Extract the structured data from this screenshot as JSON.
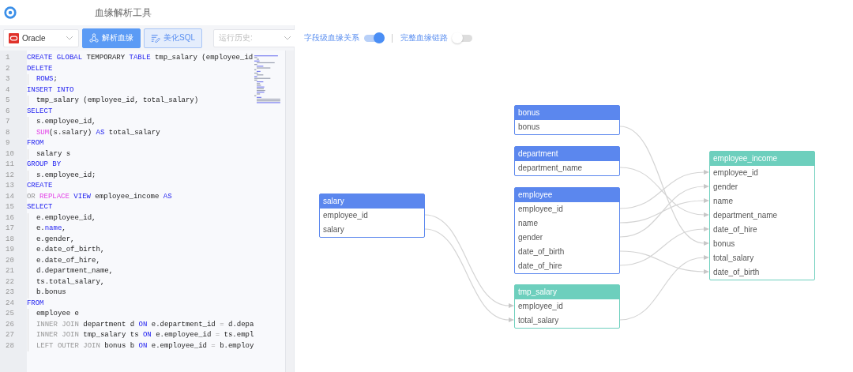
{
  "app": {
    "title": "血缘解析工具"
  },
  "toolbar": {
    "dialect": {
      "value": "Oracle"
    },
    "parse_button": "解析血缘",
    "format_button": "美化SQL",
    "history": {
      "placeholder": "运行历史:"
    }
  },
  "editor": {
    "lines": [
      {
        "no": "1",
        "indent": false,
        "tokens": [
          {
            "text": "CREATE GLOBAL",
            "kind": "keyword"
          },
          {
            "text": " TEMPORARY ",
            "kind": "plain"
          },
          {
            "text": "TABLE",
            "kind": "keyword"
          },
          {
            "text": " tmp_salary (employee_id",
            "kind": "plain"
          }
        ]
      },
      {
        "no": "2",
        "indent": false,
        "tokens": [
          {
            "text": "DELETE",
            "kind": "keyword"
          }
        ]
      },
      {
        "no": "3",
        "indent": true,
        "tokens": [
          {
            "text": "ROWS",
            "kind": "keyword"
          },
          {
            "text": ";",
            "kind": "plain"
          }
        ]
      },
      {
        "no": "4",
        "indent": false,
        "tokens": [
          {
            "text": "INSERT INTO",
            "kind": "keyword"
          }
        ]
      },
      {
        "no": "5",
        "indent": true,
        "tokens": [
          {
            "text": "tmp_salary (employee_id, total_salary)",
            "kind": "plain"
          }
        ]
      },
      {
        "no": "6",
        "indent": false,
        "tokens": [
          {
            "text": "SELECT",
            "kind": "keyword"
          }
        ]
      },
      {
        "no": "7",
        "indent": true,
        "tokens": [
          {
            "text": "s.employee_id,",
            "kind": "plain"
          }
        ]
      },
      {
        "no": "8",
        "indent": true,
        "tokens": [
          {
            "text": "SUM",
            "kind": "function"
          },
          {
            "text": "(s.salary) ",
            "kind": "plain"
          },
          {
            "text": "AS",
            "kind": "keyword"
          },
          {
            "text": " total_salary",
            "kind": "plain"
          }
        ]
      },
      {
        "no": "9",
        "indent": false,
        "tokens": [
          {
            "text": "FROM",
            "kind": "keyword"
          }
        ]
      },
      {
        "no": "10",
        "indent": true,
        "tokens": [
          {
            "text": "salary s",
            "kind": "plain"
          }
        ]
      },
      {
        "no": "11",
        "indent": false,
        "tokens": [
          {
            "text": "GROUP BY",
            "kind": "keyword"
          }
        ]
      },
      {
        "no": "12",
        "indent": true,
        "tokens": [
          {
            "text": "s.employee_id;",
            "kind": "plain"
          }
        ]
      },
      {
        "no": "13",
        "indent": false,
        "tokens": [
          {
            "text": "CREATE",
            "kind": "keyword"
          }
        ]
      },
      {
        "no": "14",
        "indent": false,
        "tokens": [
          {
            "text": "OR ",
            "kind": "operator"
          },
          {
            "text": "REPLACE ",
            "kind": "function"
          },
          {
            "text": "VIEW",
            "kind": "keyword"
          },
          {
            "text": " employee_income ",
            "kind": "plain"
          },
          {
            "text": "AS",
            "kind": "keyword"
          }
        ]
      },
      {
        "no": "15",
        "indent": false,
        "tokens": [
          {
            "text": "SELECT",
            "kind": "keyword"
          }
        ]
      },
      {
        "no": "16",
        "indent": true,
        "tokens": [
          {
            "text": "e.employee_id,",
            "kind": "plain"
          }
        ]
      },
      {
        "no": "17",
        "indent": true,
        "tokens": [
          {
            "text": "e.",
            "kind": "plain"
          },
          {
            "text": "name",
            "kind": "keyword"
          },
          {
            "text": ",",
            "kind": "plain"
          }
        ]
      },
      {
        "no": "18",
        "indent": true,
        "tokens": [
          {
            "text": "e.gender,",
            "kind": "plain"
          }
        ]
      },
      {
        "no": "19",
        "indent": true,
        "tokens": [
          {
            "text": "e.date_of_birth,",
            "kind": "plain"
          }
        ]
      },
      {
        "no": "20",
        "indent": true,
        "tokens": [
          {
            "text": "e.date_of_hire,",
            "kind": "plain"
          }
        ]
      },
      {
        "no": "21",
        "indent": true,
        "tokens": [
          {
            "text": "d.department_name,",
            "kind": "plain"
          }
        ]
      },
      {
        "no": "22",
        "indent": true,
        "tokens": [
          {
            "text": "ts.total_salary,",
            "kind": "plain"
          }
        ]
      },
      {
        "no": "23",
        "indent": true,
        "tokens": [
          {
            "text": "b.bonus",
            "kind": "plain"
          }
        ]
      },
      {
        "no": "24",
        "indent": false,
        "tokens": [
          {
            "text": "FROM",
            "kind": "keyword"
          }
        ]
      },
      {
        "no": "25",
        "indent": true,
        "tokens": [
          {
            "text": "employee e",
            "kind": "plain"
          }
        ]
      },
      {
        "no": "26",
        "indent": true,
        "tokens": [
          {
            "text": "INNER JOIN",
            "kind": "operator"
          },
          {
            "text": " department d ",
            "kind": "plain"
          },
          {
            "text": "ON",
            "kind": "keyword"
          },
          {
            "text": " e.department_id ",
            "kind": "plain"
          },
          {
            "text": "=",
            "kind": "operator"
          },
          {
            "text": " d.depa",
            "kind": "plain"
          }
        ]
      },
      {
        "no": "27",
        "indent": true,
        "tokens": [
          {
            "text": "INNER JOIN",
            "kind": "operator"
          },
          {
            "text": " tmp_salary ts ",
            "kind": "plain"
          },
          {
            "text": "ON",
            "kind": "keyword"
          },
          {
            "text": " e.employee_id ",
            "kind": "plain"
          },
          {
            "text": "=",
            "kind": "operator"
          },
          {
            "text": " ts.empl",
            "kind": "plain"
          }
        ]
      },
      {
        "no": "28",
        "indent": true,
        "tokens": [
          {
            "text": "LEFT OUTER JOIN",
            "kind": "operator"
          },
          {
            "text": " bonus b ",
            "kind": "plain"
          },
          {
            "text": "ON",
            "kind": "keyword"
          },
          {
            "text": " e.employee_id ",
            "kind": "plain"
          },
          {
            "text": "=",
            "kind": "operator"
          },
          {
            "text": " b.employ",
            "kind": "plain"
          }
        ]
      }
    ]
  },
  "options": [
    {
      "label": "字段级血缘关系",
      "on": true
    },
    {
      "label": "完整血缘链路",
      "on": false
    }
  ],
  "graph": {
    "tables": [
      {
        "name": "salary",
        "color": "#5b87ee",
        "fields": [
          "employee_id",
          "salary"
        ]
      },
      {
        "name": "bonus",
        "color": "#5b87ee",
        "fields": [
          "bonus"
        ]
      },
      {
        "name": "department",
        "color": "#5b87ee",
        "fields": [
          "department_name"
        ]
      },
      {
        "name": "employee",
        "color": "#5b87ee",
        "fields": [
          "employee_id",
          "name",
          "gender",
          "date_of_birth",
          "date_of_hire"
        ]
      },
      {
        "name": "tmp_salary",
        "color": "#6dcfbd",
        "fields": [
          "employee_id",
          "total_salary"
        ]
      },
      {
        "name": "employee_income",
        "color": "#6dcfbd",
        "fields": [
          "employee_id",
          "gender",
          "name",
          "department_name",
          "date_of_hire",
          "bonus",
          "total_salary",
          "date_of_birth"
        ]
      }
    ]
  }
}
